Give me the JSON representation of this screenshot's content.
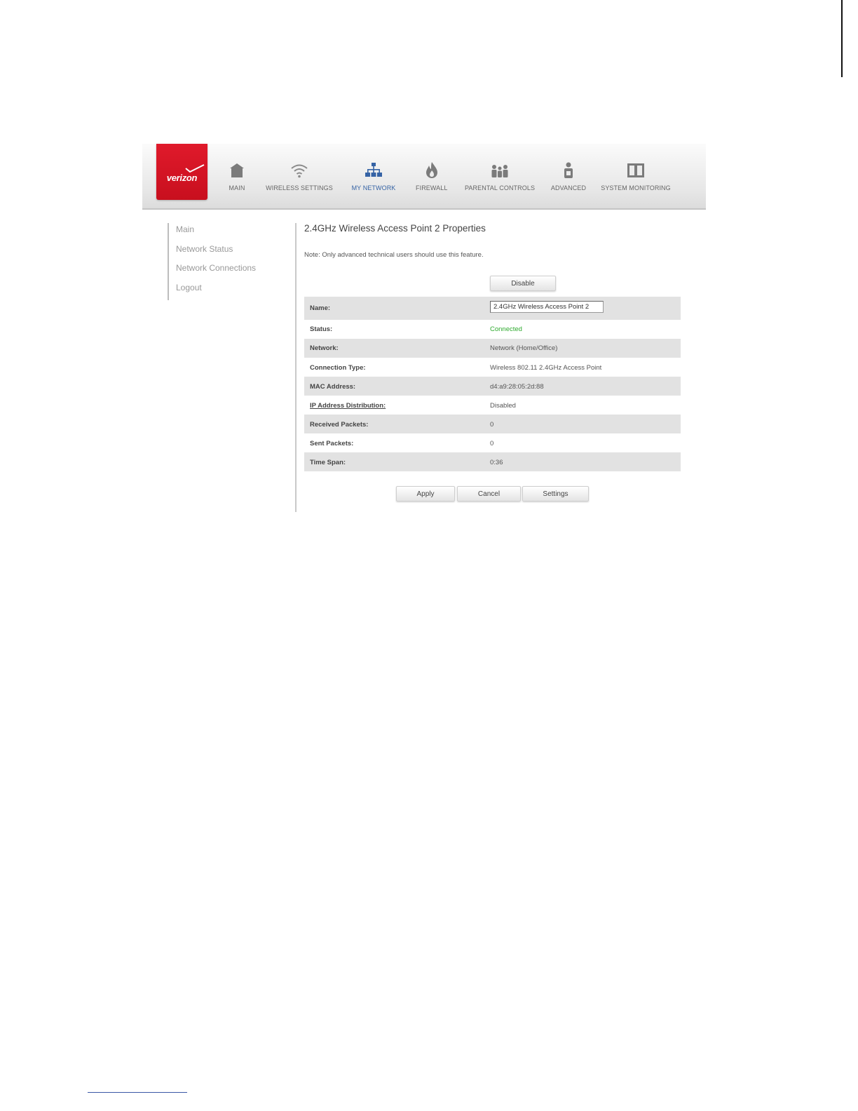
{
  "brand": {
    "logo_text": "verizon",
    "accent_color": "#cd1426"
  },
  "nav": {
    "items": [
      {
        "label": "MAIN",
        "icon": "home-icon"
      },
      {
        "label": "WIRELESS SETTINGS",
        "icon": "wifi-icon"
      },
      {
        "label": "MY NETWORK",
        "icon": "network-icon",
        "active": true
      },
      {
        "label": "FIREWALL",
        "icon": "flame-icon"
      },
      {
        "label": "PARENTAL CONTROLS",
        "icon": "family-icon"
      },
      {
        "label": "ADVANCED",
        "icon": "advanced-user-icon"
      },
      {
        "label": "SYSTEM MONITORING",
        "icon": "monitor-icon"
      }
    ],
    "active_color": "#3563a5"
  },
  "sidebar": {
    "items": [
      {
        "label": "Main"
      },
      {
        "label": "Network Status"
      },
      {
        "label": "Network Connections"
      },
      {
        "label": "Logout"
      }
    ]
  },
  "content": {
    "title": "2.4GHz Wireless Access Point 2 Properties",
    "note": "Note: Only advanced technical users should use this feature.",
    "disable_label": "Disable"
  },
  "properties": {
    "name": {
      "label": "Name:",
      "value": "2.4GHz Wireless Access Point 2"
    },
    "status": {
      "label": "Status:",
      "value": "Connected",
      "color": "#2eaa2e"
    },
    "network": {
      "label": "Network:",
      "value": "Network (Home/Office)"
    },
    "connection_type": {
      "label": "Connection Type:",
      "value": "Wireless 802.11 2.4GHz Access Point"
    },
    "mac_address": {
      "label": "MAC Address:",
      "value": "d4:a9:28:05:2d:88"
    },
    "ip_distribution": {
      "label": "IP Address Distribution:",
      "value": "Disabled"
    },
    "received_packets": {
      "label": "Received Packets:",
      "value": "0"
    },
    "sent_packets": {
      "label": "Sent Packets:",
      "value": "0"
    },
    "time_span": {
      "label": "Time Span:",
      "value": "0:36"
    }
  },
  "actions": {
    "apply_label": "Apply",
    "cancel_label": "Cancel",
    "settings_label": "Settings"
  }
}
